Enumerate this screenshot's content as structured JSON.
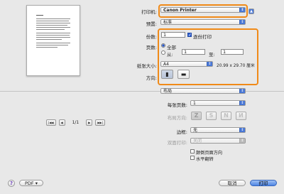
{
  "preview": {
    "page_label": "1/1",
    "nav_buttons": [
      {
        "name": "first-page-button",
        "glyph": "|◀◀"
      },
      {
        "name": "prev-page-button",
        "glyph": "◀"
      },
      {
        "name": "next-page-button",
        "glyph": "▶"
      },
      {
        "name": "last-page-button",
        "glyph": "▶▶|"
      }
    ]
  },
  "printer": {
    "label": "打印机:",
    "value": "Canon Printer"
  },
  "preset": {
    "label": "预置:",
    "value": "标准"
  },
  "copies": {
    "label": "份数:",
    "value": "1",
    "collate_label": "逐份打印",
    "collate_checked": true
  },
  "pages": {
    "label": "页数:",
    "all_label": "全部",
    "from_label": "从:",
    "from_value": "1",
    "to_label": "至:",
    "to_value": "1"
  },
  "paper_size": {
    "label": "纸张大小:",
    "value": "A4",
    "dimensions": "20.99 x 29.70 厘米"
  },
  "orientation": {
    "label": "方向:"
  },
  "section": {
    "value": "布局"
  },
  "layout": {
    "pages_per_sheet_label": "每张页数:",
    "pages_per_sheet_value": "1",
    "direction_label": "布局方向:",
    "direction_options": [
      "Z",
      "S",
      "N",
      "N"
    ],
    "border_label": "边框:",
    "border_value": "无",
    "duplex_label": "双面打印:",
    "duplex_value": "关闭",
    "reverse_label": "颠倒页面方向",
    "flip_label": "水平翻转"
  },
  "buttons": {
    "help": "?",
    "pdf": "PDF ▾",
    "cancel": "取消",
    "print": "打印"
  },
  "colors": {
    "accent": "#4a78d6",
    "highlight": "#f08a18",
    "background": "#e8e8e8"
  }
}
